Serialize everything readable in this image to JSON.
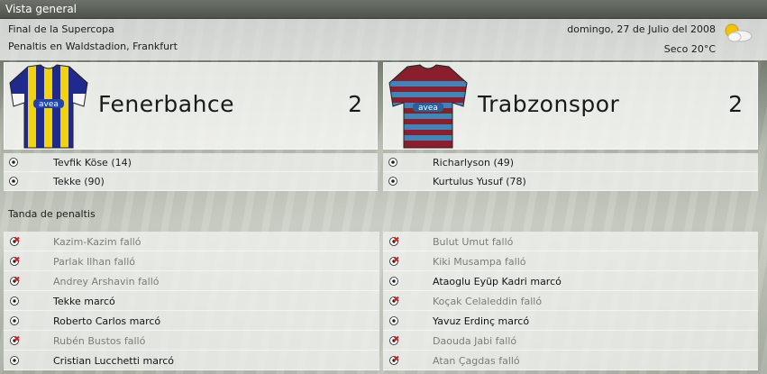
{
  "window": {
    "title": "Vista general"
  },
  "match": {
    "competition": "Final de la Supercopa",
    "venue": "Penaltis en Waldstadion, Frankfurt",
    "date": "domingo, 27 de Julio del 2008",
    "weather": "Seco 20°C",
    "weather_icon": "partly-cloudy-icon"
  },
  "home": {
    "name": "Fenerbahce",
    "score": "2",
    "shirt_colors": {
      "primary": "#1f2a8c",
      "secondary": "#f2d40c"
    },
    "scorers": [
      "Tevfik Köse (14)",
      "Tekke (90)"
    ]
  },
  "away": {
    "name": "Trabzonspor",
    "score": "2",
    "shirt_colors": {
      "primary": "#8a1e2c",
      "secondary": "#3d87b8"
    },
    "scorers": [
      "Richarlyson (49)",
      "Kurtulus Yusuf (78)"
    ]
  },
  "shootout": {
    "title": "Tanda de penaltis",
    "home": [
      {
        "text": "Kazim-Kazim falló",
        "result": "missed"
      },
      {
        "text": "Parlak Ilhan falló",
        "result": "missed"
      },
      {
        "text": "Andrey Arshavin falló",
        "result": "missed"
      },
      {
        "text": "Tekke marcó",
        "result": "scored"
      },
      {
        "text": "Roberto Carlos marcó",
        "result": "scored"
      },
      {
        "text": "Rubén Bustos falló",
        "result": "missed"
      },
      {
        "text": "Cristian Lucchetti marcó",
        "result": "scored"
      }
    ],
    "away": [
      {
        "text": "Bulut Umut falló",
        "result": "missed"
      },
      {
        "text": "Kiki Musampa falló",
        "result": "missed"
      },
      {
        "text": "Ataoglu Eyüp Kadri marcó",
        "result": "scored"
      },
      {
        "text": "Koçak Celaleddin falló",
        "result": "missed"
      },
      {
        "text": "Yavuz Erdinç marcó",
        "result": "scored"
      },
      {
        "text": "Daouda Jabi falló",
        "result": "missed"
      },
      {
        "text": "Atan Çagdas falló",
        "result": "missed"
      }
    ]
  },
  "colors": {
    "missed_marker": "#c0282c",
    "scored_marker": "#222222",
    "missed_text": "#7b7d79"
  }
}
